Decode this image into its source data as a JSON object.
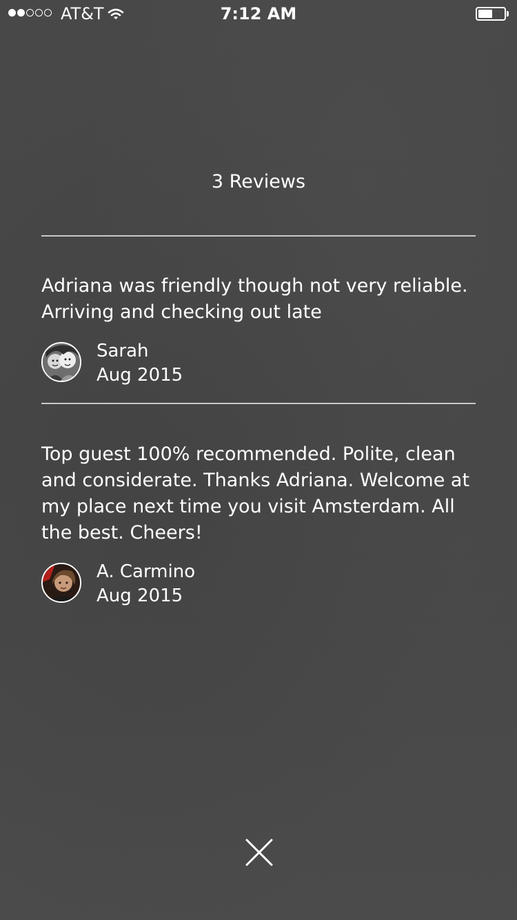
{
  "status_bar": {
    "signal_dots_filled": 2,
    "signal_dots_total": 5,
    "carrier": "AT&T",
    "time": "7:12 AM",
    "battery_level": 0.55,
    "wifi_icon": "wifi-icon"
  },
  "reviews_header": {
    "title": "3 Reviews"
  },
  "reviews": [
    {
      "text": "Adriana was friendly though not very reliable. Arriving and checking out late",
      "author": "Sarah",
      "date": "Aug 2015"
    },
    {
      "text": "Top guest 100% recommended. Polite, clean and considerate. Thanks Adriana. Welcome at my place next time you visit Amsterdam. All the best. Cheers!",
      "author": "A. Carmino",
      "date": "Aug 2015"
    }
  ],
  "close": {
    "icon": "close-icon"
  },
  "colors": {
    "background": "#4a4a4a",
    "text": "#ffffff",
    "divider": "#c9c9c9"
  }
}
